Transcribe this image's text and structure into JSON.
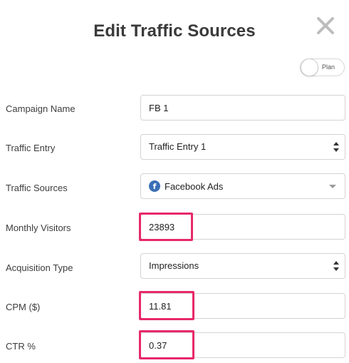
{
  "dialog": {
    "title": "Edit Traffic Sources",
    "close_icon": "close-x-icon",
    "plan_toggle_label": "Plan"
  },
  "fields": {
    "campaign_name": {
      "label": "Campaign Name",
      "value": "FB 1"
    },
    "traffic_entry": {
      "label": "Traffic Entry",
      "value": "Traffic Entry 1"
    },
    "traffic_sources": {
      "label": "Traffic Sources",
      "value": "Facebook Ads",
      "icon": "facebook-icon",
      "icon_glyph": "f"
    },
    "monthly_visitors": {
      "label": "Monthly Visitors",
      "value": "23893"
    },
    "acquisition_type": {
      "label": "Acquisition Type",
      "value": "Impressions"
    },
    "cpm": {
      "label": "CPM ($)",
      "value": "11.81"
    },
    "ctr": {
      "label": "CTR %",
      "value": "0.37"
    }
  },
  "colors": {
    "highlight": "#e8286b",
    "facebook_blue": "#3b6fb6"
  }
}
